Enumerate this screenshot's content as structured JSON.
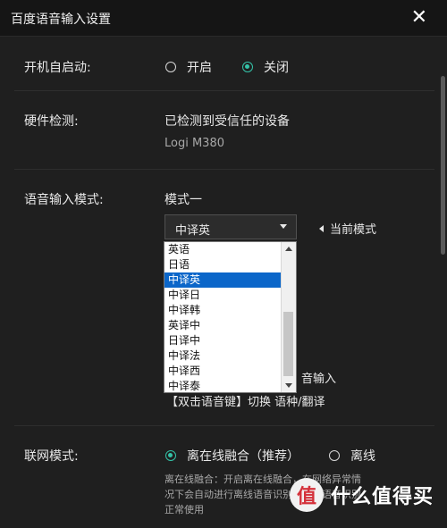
{
  "window": {
    "title": "百度语音输入设置",
    "close_label": "✕"
  },
  "autostart": {
    "label": "开机自启动:",
    "options": [
      {
        "label": "开启",
        "selected": false
      },
      {
        "label": "关闭",
        "selected": true
      }
    ]
  },
  "hardware": {
    "label": "硬件检测:",
    "status": "已检测到受信任的设备",
    "device": "Logi M380"
  },
  "voice_mode": {
    "label": "语音输入模式:",
    "mode_name": "模式一",
    "selected": "中译英",
    "current_mode_hint": "当前模式",
    "options": [
      "英语",
      "日语",
      "中译英",
      "中译日",
      "中译韩",
      "英译中",
      "日译中",
      "中译法",
      "中译西",
      "中译泰"
    ],
    "hint_partial": "音输入",
    "switch_hint": "【双击语音键】切换 语种/翻译"
  },
  "network": {
    "label": "联网模式:",
    "options": [
      {
        "label": "离在线融合（推荐）",
        "selected": true
      },
      {
        "label": "离线",
        "selected": false
      }
    ],
    "desc_line1": "离在线融合：开启离在线融合，在网络异常情",
    "desc_line2": "况下会自动进行离线语音识别，确保语音识别",
    "desc_line3": "正常使用"
  },
  "watermark": {
    "badge": "值",
    "text": "什么值得买"
  },
  "colors": {
    "accent": "#34c3a8",
    "selection": "#0b66c9",
    "background": "#1f1f1f"
  }
}
